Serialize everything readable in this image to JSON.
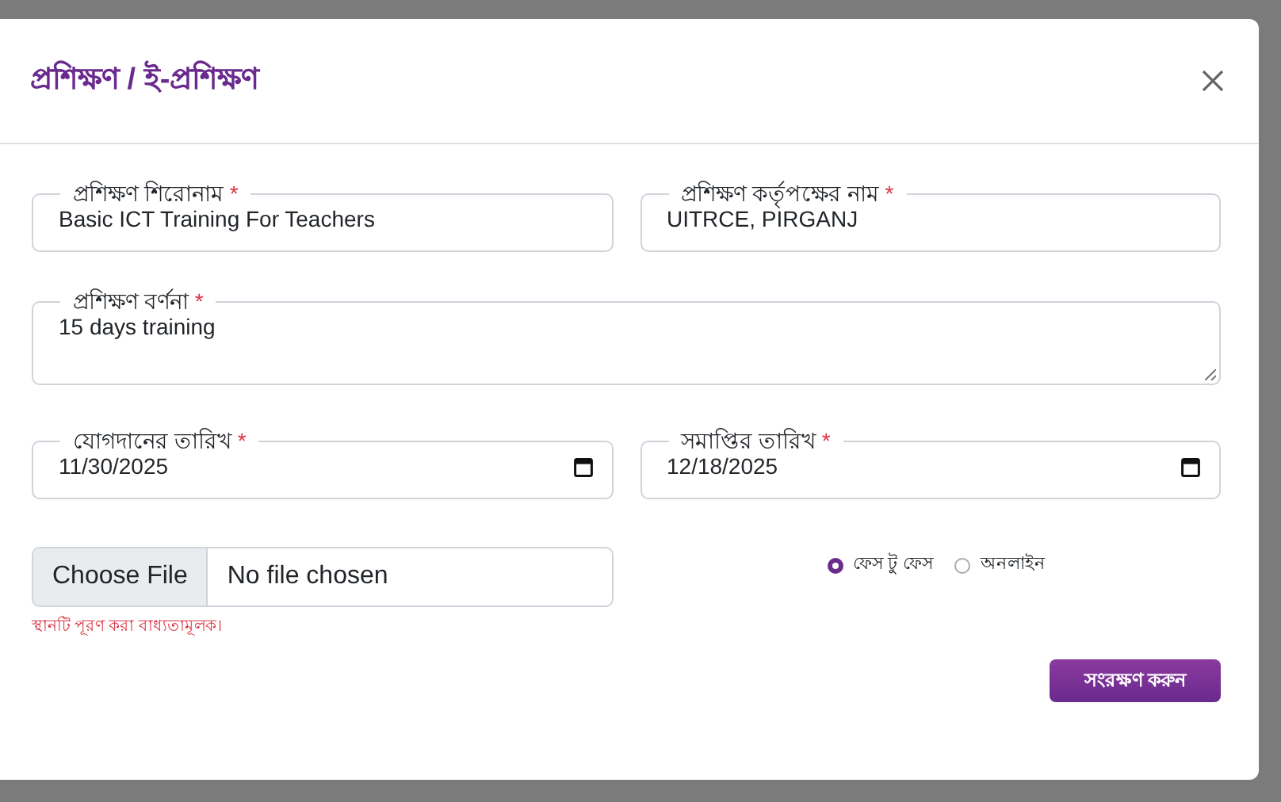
{
  "modal": {
    "title": "প্রশিক্ষণ / ই-প্রশিক্ষণ",
    "fields": [
      {
        "kind": "text",
        "label": "প্রশিক্ষণ শিরোনাম",
        "required_mark": "*",
        "value": "Basic ICT Training For Teachers"
      },
      {
        "kind": "text",
        "label": "প্রশিক্ষণ কর্তৃপক্ষের নাম",
        "required_mark": "*",
        "value": "UITRCE, PIRGANJ"
      },
      {
        "kind": "textarea",
        "label": "প্রশিক্ষণ বর্ণনা",
        "required_mark": "*",
        "value": "15 days training"
      },
      {
        "kind": "date",
        "label": "যোগদানের তারিখ",
        "required_mark": "*",
        "value": "11/30/2025"
      },
      {
        "kind": "date",
        "label": "সমাপ্তির তারিখ",
        "required_mark": "*",
        "value": "12/18/2025"
      }
    ],
    "file": {
      "button": "Choose File",
      "status": "No file chosen",
      "error": "স্থানটি পূরণ করা বাধ্যতামূলক।"
    },
    "mode_options": [
      {
        "label": "ফেস টু ফেস",
        "selected": true
      },
      {
        "label": "অনলাইন",
        "selected": false
      }
    ],
    "save_button": "সংরক্ষণ করুন"
  }
}
